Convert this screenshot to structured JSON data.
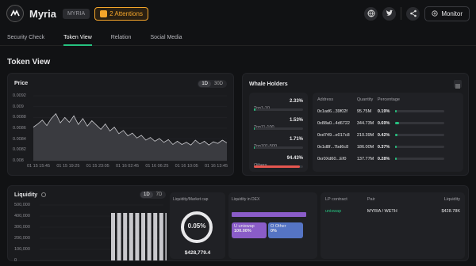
{
  "header": {
    "name": "Myria",
    "ticker": "MYRIA",
    "attentions": "2 Attentions",
    "monitor_label": "Monitor"
  },
  "tabs": [
    "Security Check",
    "Token View",
    "Relation",
    "Social Media"
  ],
  "active_tab": 1,
  "page_title": "Token View",
  "price": {
    "title": "Price",
    "ranges": [
      "1D",
      "30D"
    ],
    "y_ticks": [
      "0.0092",
      "0.009",
      "0.0088",
      "0.0086",
      "0.0084",
      "0.0082",
      "0.008"
    ],
    "x_ticks": [
      "01 15 15:45",
      "01 15 19:25",
      "01 15 23:05",
      "01 16 02:45",
      "01 16 06:25",
      "01 16 10:05",
      "01 16 13:45"
    ]
  },
  "chart_data": {
    "type": "area",
    "title": "Price",
    "ylim": [
      0.008,
      0.0092
    ],
    "x": [
      "01 15 15:45",
      "01 15 19:25",
      "01 15 23:05",
      "01 16 02:45",
      "01 16 06:25",
      "01 16 10:05",
      "01 16 13:45"
    ],
    "values": [
      0.00862,
      0.00868,
      0.00875,
      0.00865,
      0.00878,
      0.00887,
      0.0087,
      0.0088,
      0.00871,
      0.00883,
      0.00867,
      0.00878,
      0.00864,
      0.00874,
      0.00866,
      0.00858,
      0.00868,
      0.00855,
      0.00862,
      0.0085,
      0.00856,
      0.00846,
      0.00851,
      0.00842,
      0.00847,
      0.00838,
      0.00843,
      0.00836,
      0.00841,
      0.00834,
      0.00839,
      0.0083,
      0.00836,
      0.0083,
      0.00834,
      0.00829,
      0.00838,
      0.00831,
      0.00836,
      0.00829,
      0.00835,
      0.00832,
      0.00838,
      0.00833
    ]
  },
  "whale": {
    "title": "Whale Holders",
    "groups": [
      {
        "label": "Top1-10",
        "pct": "2.33%",
        "fill": 0.03,
        "color": "#26c280"
      },
      {
        "label": "Top11-100",
        "pct": "1.53%",
        "fill": 0.02,
        "color": "#26c280"
      },
      {
        "label": "Top101-500",
        "pct": "1.71%",
        "fill": 0.02,
        "color": "#26c280"
      },
      {
        "label": "Others",
        "pct": "94.43%",
        "fill": 0.94,
        "color": "#e5564f"
      }
    ],
    "headers": [
      "Address",
      "Quantity",
      "Percentage"
    ],
    "rows": [
      {
        "address": "0x1ad6...39f02f",
        "quantity": "95.75M",
        "pct": "0.19%",
        "fill": 0.03
      },
      {
        "address": "0x88a0...4d6722",
        "quantity": "344.73M",
        "pct": "0.69%",
        "fill": 0.08
      },
      {
        "address": "0xd749...e017c8",
        "quantity": "210.39M",
        "pct": "0.42%",
        "fill": 0.05
      },
      {
        "address": "0x1d8f...7bd6c8",
        "quantity": "186.00M",
        "pct": "0.37%",
        "fill": 0.04
      },
      {
        "address": "0xr0Xd60...Ef0",
        "quantity": "137.77M",
        "pct": "0.28%",
        "fill": 0.03
      }
    ]
  },
  "liquidity": {
    "title": "Liquidity",
    "ranges": [
      "1D",
      "7D"
    ],
    "y_ticks": [
      "500,000",
      "400,000",
      "300,000",
      "200,000",
      "100,000",
      "0"
    ],
    "bars": [
      428779,
      428779,
      428779,
      428779,
      428779,
      428779,
      428779,
      428779,
      428779,
      428779
    ],
    "mcap_title": "Liquidity/Market cap",
    "mcap_pct": "0.05%",
    "mcap_value": "$428,779.4",
    "dex_title": "Liquidity in DEX",
    "dex_items": [
      {
        "code": "U",
        "name": "uniswap",
        "pct": "100.00%"
      },
      {
        "code": "O",
        "name": "Other",
        "pct": "0%"
      }
    ],
    "lp_headers": [
      "LP contract",
      "Pair",
      "Liquidity"
    ],
    "lp_rows": [
      {
        "contract": "uniswap",
        "pair": "MYRIA / WETH",
        "liquidity": "$428.78K"
      }
    ]
  }
}
